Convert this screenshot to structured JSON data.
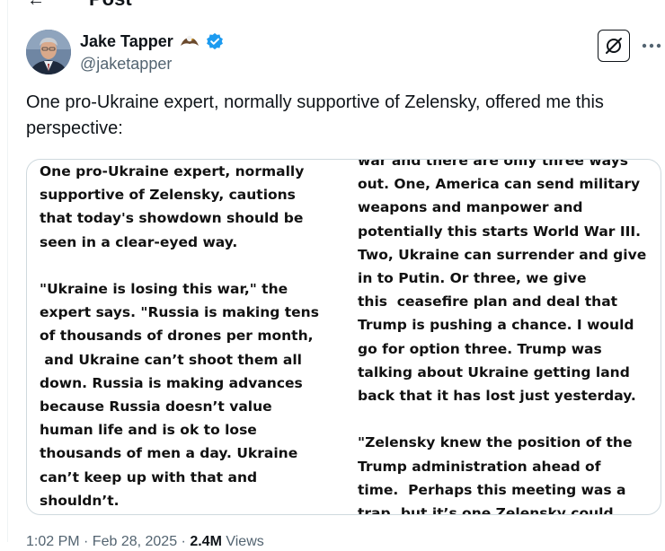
{
  "header": {
    "title": "Post"
  },
  "author": {
    "name": "Jake Tapper",
    "handle": "@jaketapper"
  },
  "tweet": {
    "text": "One pro-Ukraine expert, normally supportive of Zelensky, offered me this perspective:"
  },
  "media": {
    "left_column": [
      "One pro-Ukraine expert, normally",
      "supportive of Zelensky, cautions",
      "that today's showdown should be",
      "seen in a clear-eyed way.",
      "",
      "\"Ukraine is losing this war,\" the",
      "expert says. \"Russia is making tens",
      "of thousands of drones per month,",
      " and Ukraine can’t shoot them all",
      "down. Russia is making advances",
      "because Russia doesn’t value",
      "human life and is ok to lose",
      "thousands of men a day. Ukraine",
      "can’t keep up with that and",
      "shouldn’t."
    ],
    "right_column": [
      "war and there are only three ways",
      "out. One, America can send military",
      "weapons and manpower and",
      "potentially this starts World War III.",
      "Two, Ukraine can surrender and give",
      "in to Putin. Or three, we give",
      "this  ceasefire plan and deal that",
      "Trump is pushing a chance. I would",
      "go for option three. Trump was",
      "talking about Ukraine getting land",
      "back that it has lost just yesterday.",
      "",
      "\"Zelensky knew the position of the",
      "Trump administration ahead of",
      "time.  Perhaps this meeting was a",
      "trap, but it’s one Zelensky could"
    ]
  },
  "footer": {
    "timestamp": "1:02 PM · Feb 28, 2025 ·",
    "views_count": "2.4M",
    "views_label": "Views"
  },
  "icons": {
    "verified": "verified-badge-icon",
    "grok": "grok-icon",
    "more": "more-icon",
    "back": "back-arrow-icon",
    "eagle": "eagle-emoji-icon"
  },
  "colors": {
    "verified": "#1d9bf0",
    "secondary_text": "#536471",
    "border": "#cfd9de"
  }
}
